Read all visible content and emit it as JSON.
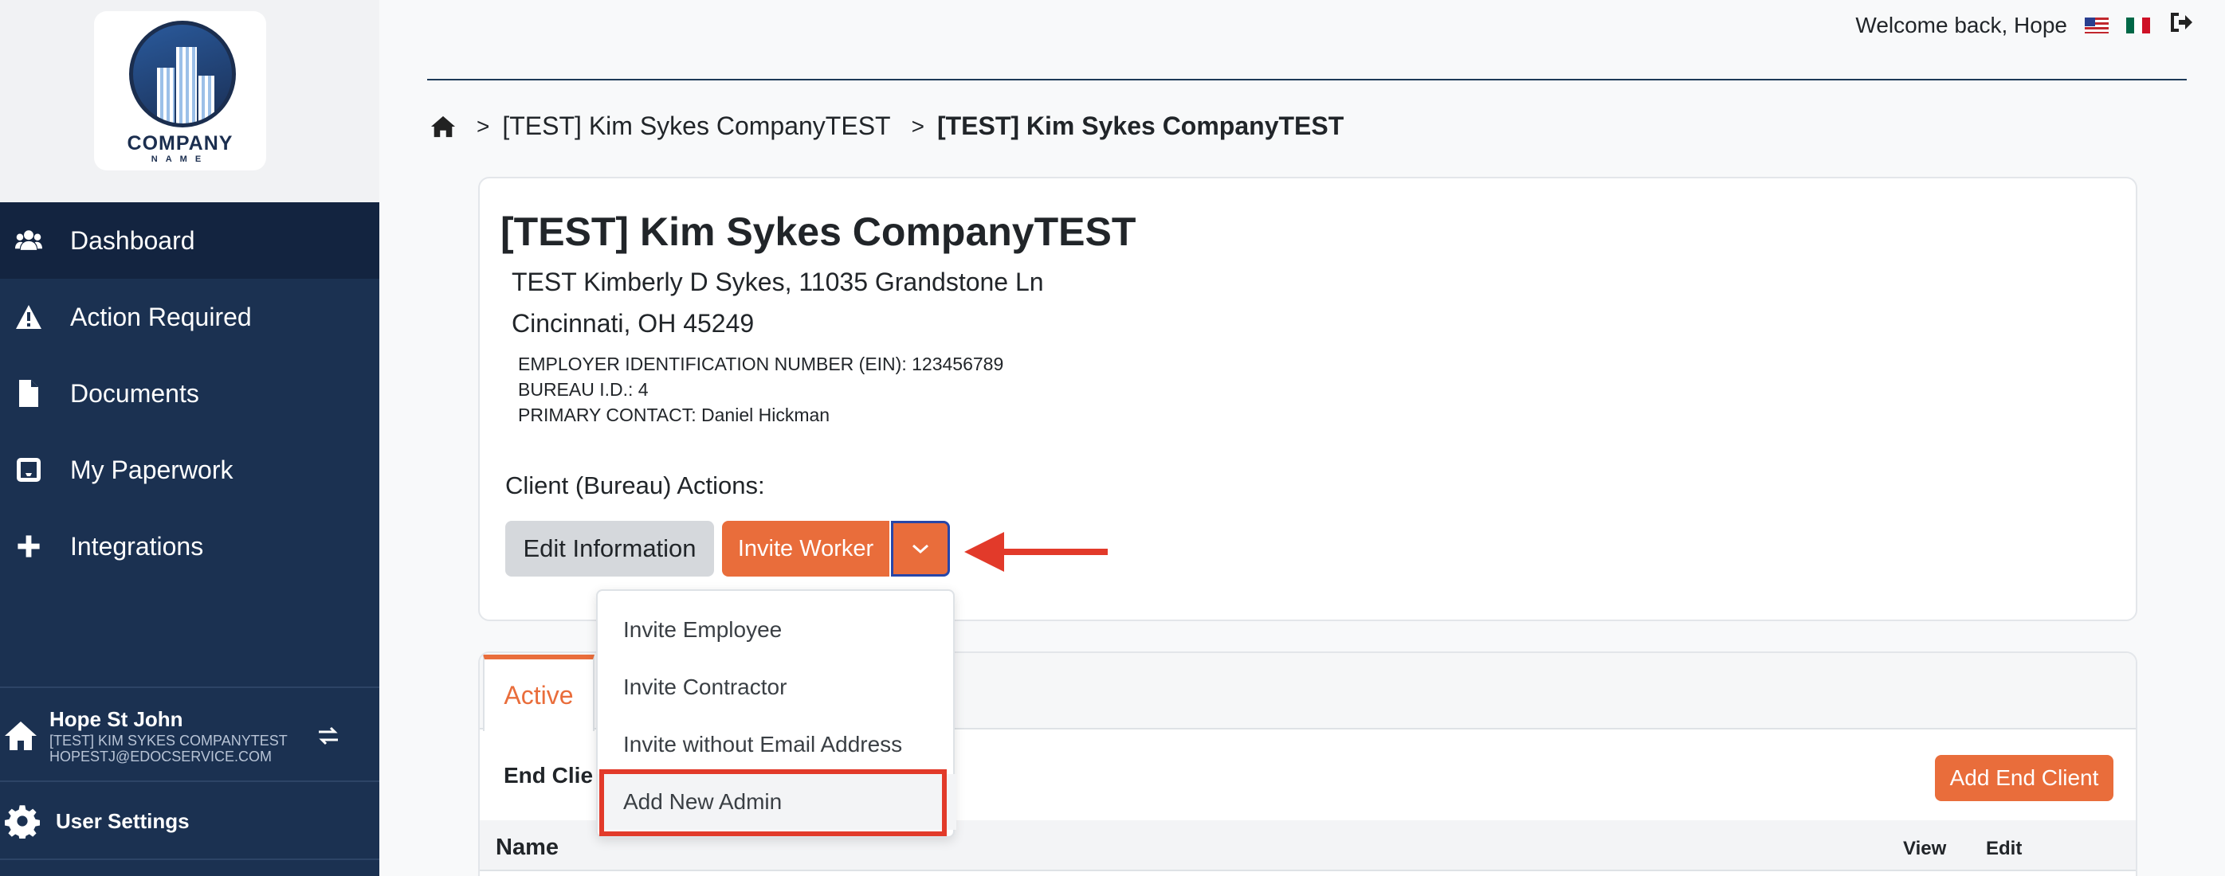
{
  "logo": {
    "word": "COMPANY",
    "sub": "NAME"
  },
  "sidebar": {
    "items": [
      {
        "label": "Dashboard",
        "icon": "users-icon"
      },
      {
        "label": "Action Required",
        "icon": "warning-icon"
      },
      {
        "label": "Documents",
        "icon": "file-icon"
      },
      {
        "label": "My Paperwork",
        "icon": "inbox-icon"
      },
      {
        "label": "Integrations",
        "icon": "plus-icon"
      }
    ],
    "user": {
      "name": "Hope St John",
      "company": "[TEST] KIM SYKES COMPANYTEST",
      "email": "HOPESTJ@EDOCSERVICE.COM"
    },
    "settings_label": "User Settings"
  },
  "topbar": {
    "welcome": "Welcome back, Hope"
  },
  "breadcrumb": {
    "items": [
      "[TEST] Kim Sykes CompanyTEST",
      "[TEST] Kim Sykes CompanyTEST"
    ]
  },
  "company": {
    "title": "[TEST] Kim Sykes CompanyTEST",
    "address_line1": "TEST Kimberly D Sykes, 11035 Grandstone Ln",
    "address_line2": "Cincinnati, OH 45249",
    "ein": "EMPLOYER IDENTIFICATION NUMBER (EIN): 123456789",
    "bureau_id": "BUREAU I.D.: 4",
    "primary_contact": "PRIMARY CONTACT: Daniel Hickman"
  },
  "actions": {
    "label": "Client (Bureau) Actions:",
    "edit_label": "Edit Information",
    "invite_label": "Invite Worker"
  },
  "menu": {
    "items": [
      "Invite Employee",
      "Invite Contractor",
      "Invite without Email Address",
      "Add New Admin"
    ]
  },
  "tabs": {
    "active_label": "Active"
  },
  "end_clients": {
    "heading": "End Clie",
    "add_label": "Add End Client",
    "columns": [
      "Name",
      "View",
      "Edit"
    ]
  },
  "colors": {
    "sidebar": "#1b3151",
    "accent": "#e96d3b",
    "annotation": "#e23a2a"
  }
}
